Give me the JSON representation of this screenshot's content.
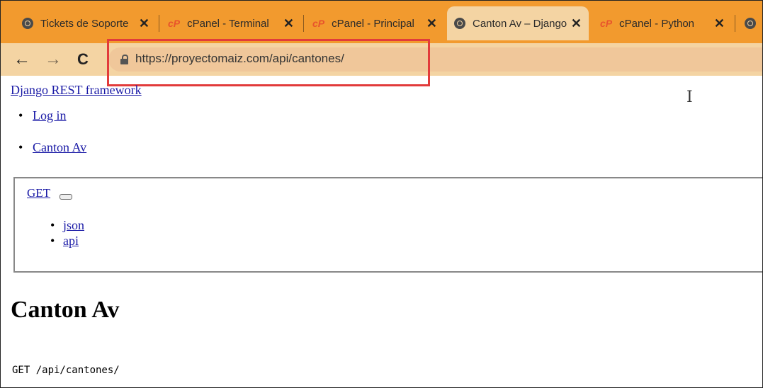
{
  "browser": {
    "tabs": [
      {
        "title": "Tickets de Soporte",
        "icon": "globe-icon",
        "active": false
      },
      {
        "title": "cPanel - Terminal",
        "icon": "cpanel-icon",
        "active": false
      },
      {
        "title": "cPanel - Principal",
        "icon": "cpanel-icon",
        "active": false
      },
      {
        "title": "Canton Av – Django",
        "icon": "globe-icon",
        "active": true
      },
      {
        "title": "cPanel - Python",
        "icon": "cpanel-icon",
        "active": false
      }
    ],
    "close_glyph": "✕",
    "cpanel_glyph": "cP",
    "back_glyph": "←",
    "forward_glyph": "→",
    "reload_glyph": "C",
    "url": "https://proyectomaiz.com/api/cantones/"
  },
  "page": {
    "brand": "Django REST framework",
    "nav": [
      "Log in",
      "Canton Av"
    ],
    "get_label": "GET",
    "formats": [
      "json",
      "api"
    ],
    "heading": "Canton Av",
    "request_line": "GET /api/cantones/"
  },
  "colors": {
    "tabbar": "#f29a2e",
    "active_tab": "#f4d4a3",
    "highlight": "#e23b3b",
    "link": "#1a1aa6"
  }
}
